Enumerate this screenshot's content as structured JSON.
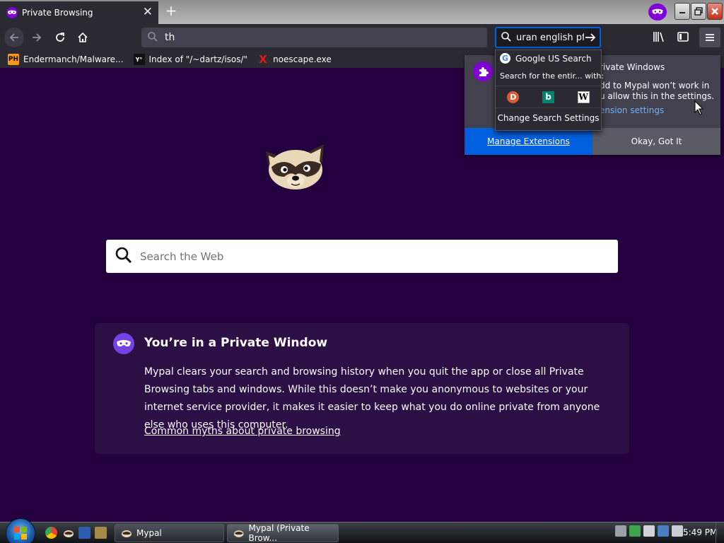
{
  "window": {
    "tab_title": "Private Browsing",
    "tab_close": "✕",
    "new_tab": "+"
  },
  "navbar": {
    "url_value": "th",
    "search_value": "uran english pf"
  },
  "bookmarks": [
    {
      "favicon": "PH",
      "label": "Endermanch/Malware..."
    },
    {
      "favicon": "Y°",
      "label": "Index of \"/~dartz/isos/\""
    },
    {
      "favicon": "X",
      "label": "noescape.exe"
    }
  ],
  "main": {
    "search_placeholder": "Search the Web",
    "private_title": "You’re in a Private Window",
    "private_body": "Mypal clears your search and browsing history when you quit the app or close all Private Browsing tabs and windows. While this doesn’t make you anonymous to websites or your internet service provider, it makes it easier to keep what you do online private from anyone else who uses this computer.",
    "private_link": "Common myths about private browsing"
  },
  "extension_panel": {
    "heading": "rivate Windows",
    "text_line1": "dd to Mypal won’t work in",
    "text_line2": "u allow this in the settings.",
    "link": "ension settings",
    "manage_button": "Manage Extensions",
    "okay_button": "Okay, Got It"
  },
  "search_popup": {
    "engine_name": "Google US Search",
    "header": "Search for the entir... with:",
    "change_settings": "Change Search Settings",
    "engines": [
      "duckduckgo-icon",
      "bing-icon",
      "wikipedia-icon"
    ]
  },
  "taskbar": {
    "tasks": [
      "Mypal",
      "Mypal (Private Brow..."
    ],
    "clock": "5:49 PM"
  },
  "colors": {
    "page_bg": "#25003e",
    "accent_blue": "#0060df",
    "private_purple": "#8000d7"
  }
}
